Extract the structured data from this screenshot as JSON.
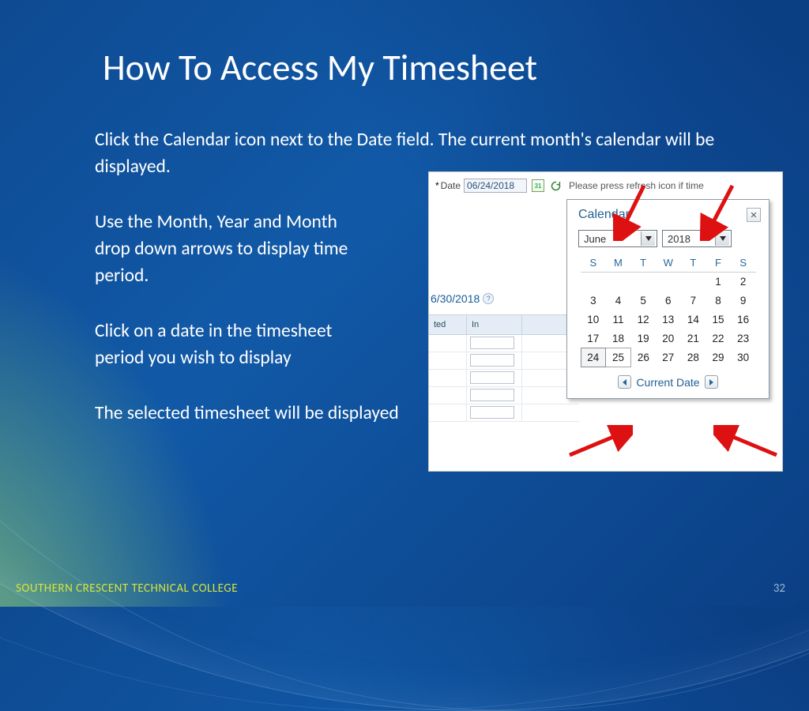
{
  "slide": {
    "title": "How To Access My Timesheet",
    "para1": "Click the Calendar icon next to the Date field.  The current month's calendar will be displayed.",
    "para2a": "Use the Month, Year and Month",
    "para2b": "drop down arrows to display time",
    "para2c": "period.",
    "para3a": "Click on a date in the timesheet",
    "para3b": "period you wish to display",
    "para4": "The selected timesheet will be displayed",
    "footer_college": "SOUTHERN CRESCENT TECHNICAL COLLEGE",
    "page_number": "32"
  },
  "app": {
    "date_label": "Date",
    "required_mark": "*",
    "date_value": "06/24/2018",
    "refresh_hint": "Please press refresh icon if time",
    "bg_date": "6/30/2018",
    "col_ted": "ted",
    "col_in": "In",
    "calendar": {
      "title": "Calendar",
      "close": "✕",
      "month": "June",
      "year": "2018",
      "dow": [
        "S",
        "M",
        "T",
        "W",
        "T",
        "F",
        "S"
      ],
      "weeks": [
        [
          "",
          "",
          "",
          "",
          "",
          "1",
          "2"
        ],
        [
          "3",
          "4",
          "5",
          "6",
          "7",
          "8",
          "9"
        ],
        [
          "10",
          "11",
          "12",
          "13",
          "14",
          "15",
          "16"
        ],
        [
          "17",
          "18",
          "19",
          "20",
          "21",
          "22",
          "23"
        ],
        [
          "24",
          "25",
          "26",
          "27",
          "28",
          "29",
          "30"
        ]
      ],
      "selected": [
        24,
        25
      ],
      "current_date_label": "Current Date"
    }
  }
}
